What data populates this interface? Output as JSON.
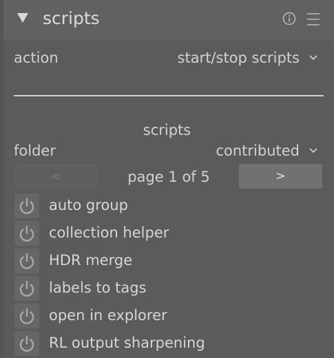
{
  "header": {
    "title": "scripts",
    "expand_icon": "triangle-down-icon",
    "info_icon": "info-circle-icon",
    "menu_icon": "hamburger-menu-icon"
  },
  "action": {
    "label": "action",
    "value": "start/stop scripts"
  },
  "scripts_section": {
    "title": "scripts",
    "folder_label": "folder",
    "folder_value": "contributed"
  },
  "pager": {
    "prev_label": "<",
    "page_label": "page 1 of 5",
    "next_label": ">"
  },
  "scripts": [
    {
      "label": "auto group"
    },
    {
      "label": "collection helper"
    },
    {
      "label": "HDR merge"
    },
    {
      "label": "labels to tags"
    },
    {
      "label": "open in explorer"
    },
    {
      "label": "RL output sharpening"
    }
  ],
  "colors": {
    "background": "#5b5b5b",
    "header": "#616161",
    "text": "#d2d2d2",
    "button_active": "#717171"
  }
}
